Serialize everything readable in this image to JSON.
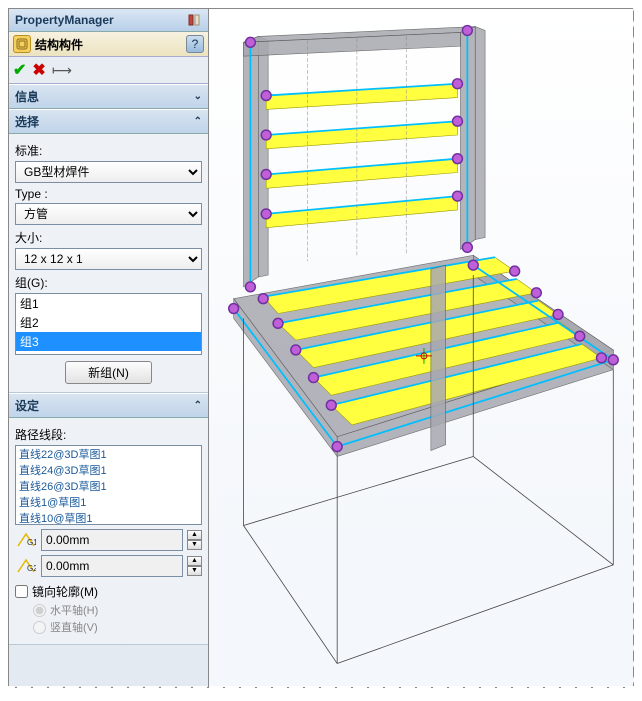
{
  "header": {
    "title": "PropertyManager"
  },
  "feature": {
    "title": "结构构件"
  },
  "sections": {
    "info": {
      "title": "信息"
    },
    "select": {
      "title": "选择",
      "standard_label": "标准:",
      "standard_value": "GB型材焊件",
      "type_label": "Type :",
      "type_value": "方管",
      "size_label": "大小:",
      "size_value": "12 x 12 x 1",
      "group_label": "组(G):",
      "groups": [
        "组1",
        "组2",
        "组3"
      ],
      "selected_group_index": 2,
      "new_group_btn": "新组(N)"
    },
    "settings": {
      "title": "设定",
      "path_label": "路径线段:",
      "paths": [
        "直线22@3D草图1",
        "直线24@3D草图1",
        "直线26@3D草图1",
        "直线1@草图1",
        "直线10@草图1"
      ],
      "g1_value": "0.00mm",
      "g2_value": "0.00mm",
      "mirror_label": "镜向轮廓(M)",
      "mirror_checked": false,
      "axis_h": "水平轴(H)",
      "axis_v": "竖直轴(V)"
    }
  }
}
